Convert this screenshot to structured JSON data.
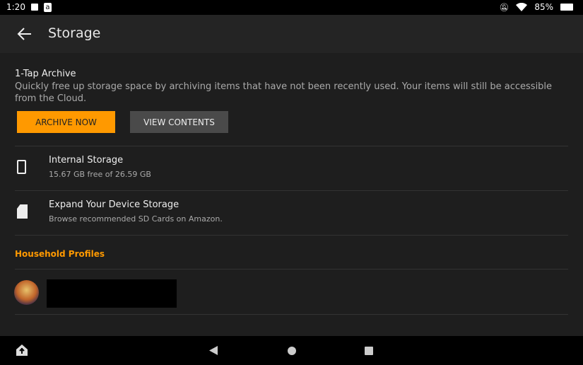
{
  "status": {
    "time": "1:20",
    "battery": "85%"
  },
  "header": {
    "title": "Storage"
  },
  "archive": {
    "title": "1-Tap Archive",
    "description": "Quickly free up storage space by archiving items that have not been recently used. Your items will still be accessible from the Cloud.",
    "archive_button": "ARCHIVE NOW",
    "view_button": "VIEW CONTENTS"
  },
  "internal": {
    "title": "Internal Storage",
    "detail": "15.67 GB free of 26.59 GB"
  },
  "expand": {
    "title": "Expand Your Device Storage",
    "detail": "Browse recommended SD Cards on Amazon."
  },
  "household": {
    "title": "Household Profiles"
  },
  "colors": {
    "accent": "#ff9900"
  }
}
